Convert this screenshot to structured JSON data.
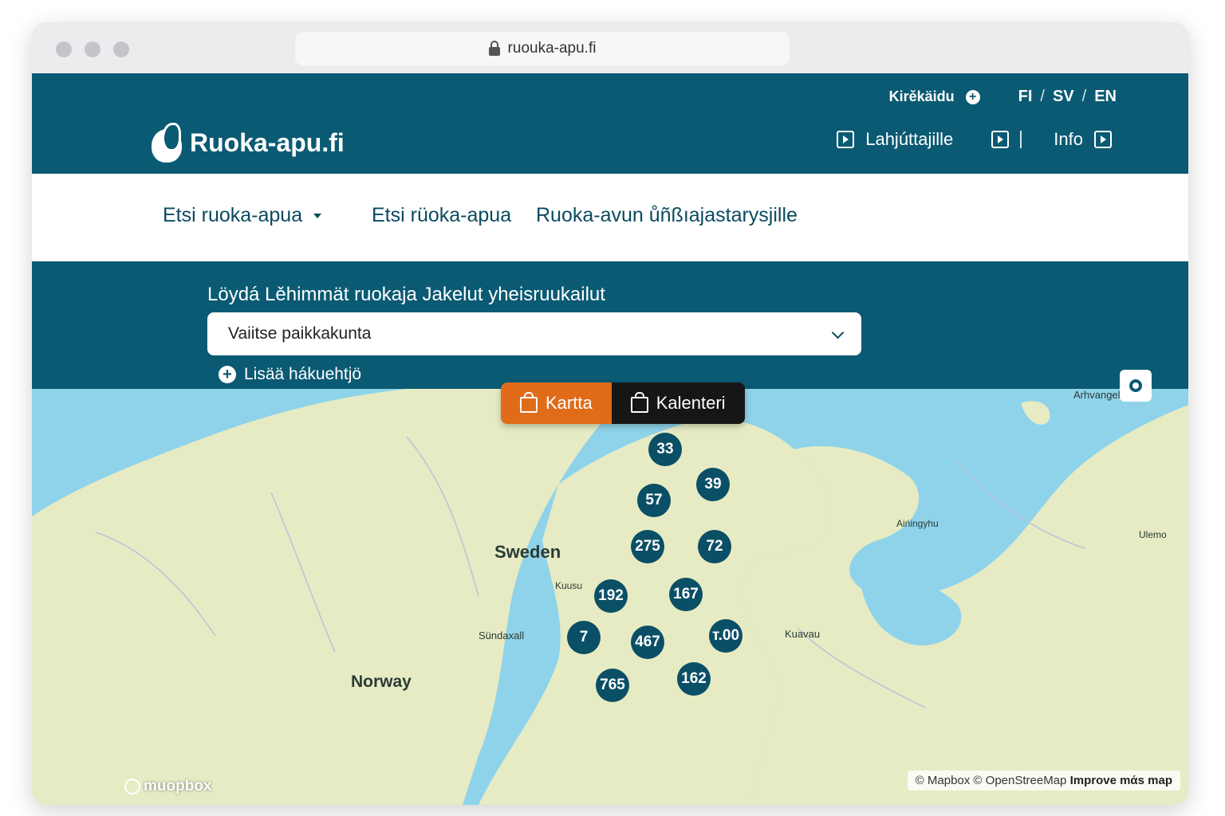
{
  "browser": {
    "url": "ruouka-apu.fi"
  },
  "utility": {
    "link_label": "Kirěkäidu",
    "langs": [
      "FI",
      "SV",
      "EN"
    ],
    "lang_sep": "/"
  },
  "brand": {
    "logo_text": "Ruoka-apu.fi"
  },
  "rightnav": {
    "lahjuttajille": "Lahjúttajille",
    "info": "Info"
  },
  "nav": {
    "item1": "Etsi ruoka-apua",
    "item2": "Etsi rüoka-apua",
    "item3": "Ruoka-avun ůñßıajastarysjille"
  },
  "search": {
    "title": "Löydá Lěhimmät ruokaja Jakelut yheisruukailut",
    "select_value": "Vaiitse paikkakunta",
    "add_filter": "Lisää hákuehtjö"
  },
  "tabs": {
    "map": "Kartta",
    "calendar": "Kalenteri"
  },
  "map": {
    "labels": {
      "sweden": "Sweden",
      "norway": "Norway",
      "kuusu": "Kuusu",
      "sundaxall": "Sündaxall",
      "kuavau": "Kuavau",
      "arhangelsk": "Arhvangeluk -",
      "ainingyhu": "Aińingyhu",
      "ulemo": "Ulemo"
    },
    "clusters": [
      "7",
      "33",
      "39",
      "57",
      "275",
      "72",
      "192",
      "167",
      "7",
      "467",
      "т.00",
      "765",
      "162"
    ],
    "attribution": {
      "mapbox": "Mapbox",
      "osm": "OpenStreeMap",
      "improve": "Improve mάs map"
    },
    "logo": "muopbox"
  },
  "colors": {
    "brand": "#0b5a73",
    "accent": "#e06c1a",
    "water": "#8fd3ea",
    "land": "#e6ebc4"
  }
}
